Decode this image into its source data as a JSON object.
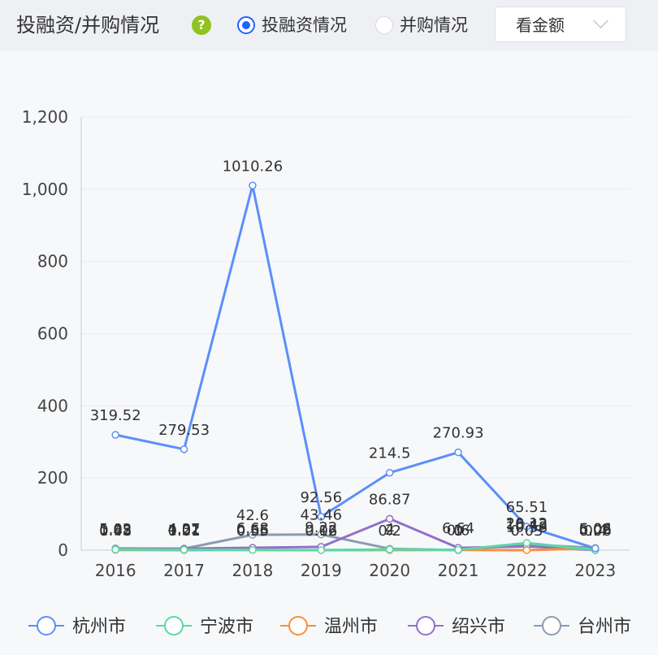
{
  "header": {
    "title": "投融资/并购情况",
    "help_icon": "question-mark-icon",
    "radio_options": [
      {
        "label": "投融资情况",
        "checked": true
      },
      {
        "label": "并购情况",
        "checked": false
      }
    ],
    "select_value": "看金额"
  },
  "chart_data": {
    "type": "line",
    "categories": [
      "2016",
      "2017",
      "2018",
      "2019",
      "2020",
      "2021",
      "2022",
      "2023"
    ],
    "y_ticks": [
      "0",
      "200",
      "400",
      "600",
      "800",
      "1,000",
      "1,200"
    ],
    "ylim": [
      0,
      1200
    ],
    "grid": true,
    "legend_position": "bottom",
    "series": [
      {
        "name": "杭州市",
        "color": "#5b8ff9",
        "values": [
          319.52,
          279.53,
          1010.26,
          92.56,
          214.5,
          270.93,
          65.51,
          5.06
        ]
      },
      {
        "name": "宁波市",
        "color": "#5ad8a6",
        "values": [
          1.62,
          1.21,
          0.55,
          0.12,
          2,
          1,
          20.12,
          0.4
        ]
      },
      {
        "name": "温州市",
        "color": "#f6903d",
        "values": [
          0.48,
          0.01,
          0.66,
          0.06,
          0.2,
          0.6,
          0.03,
          5.02
        ]
      },
      {
        "name": "绍兴市",
        "color": "#9270ca",
        "values": [
          0.93,
          4.02,
          6.68,
          9.22,
          86.87,
          6.64,
          10.58,
          0.06
        ]
      },
      {
        "name": "台州市",
        "color": "#8a9cb0",
        "values": [
          5.03,
          4.37,
          42.6,
          43.46,
          4.0,
          0.0,
          16.43,
          6.06
        ]
      }
    ]
  }
}
